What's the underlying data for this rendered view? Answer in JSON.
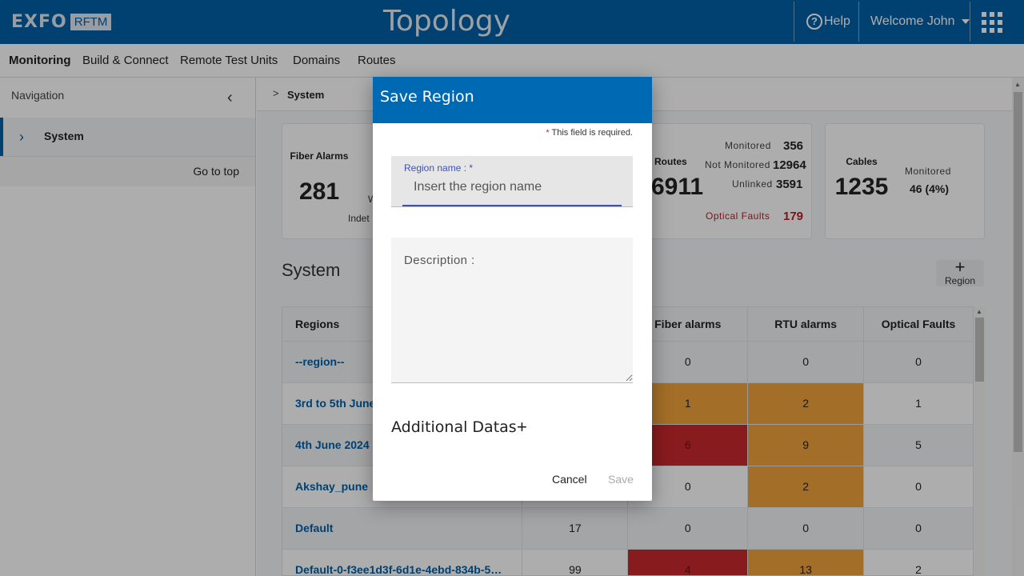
{
  "header": {
    "logo_brand": "EXFO",
    "logo_product": "RFTM",
    "title": "Topology",
    "help_label": "Help",
    "welcome_label": "Welcome John"
  },
  "menu": {
    "items": [
      "Monitoring",
      "Build & Connect",
      "Remote Test Units",
      "Domains",
      "Routes"
    ],
    "active": "Monitoring"
  },
  "sidebar": {
    "title": "Navigation",
    "item_label": "System",
    "go_to_top": "Go to top"
  },
  "breadcrumb": {
    "label": "System"
  },
  "summary": {
    "fiber_label": "Fiber Alarms",
    "fiber_count": "281",
    "partial_w": "W",
    "partial_indet": "Indet",
    "routes_label": "Routes",
    "routes_count": "6911",
    "routes_monitored_label": "Monitored",
    "routes_monitored_value": "356",
    "routes_not_monitored_label": "Not Monitored",
    "routes_not_monitored_value": "12964",
    "routes_unlinked_label": "Unlinked",
    "routes_unlinked_value": "3591",
    "optical_faults_label": "Optical Faults",
    "optical_faults_value": "179",
    "cables_label": "Cables",
    "cables_count": "1235",
    "cables_monitored_label": "Monitored",
    "cables_monitored_value": "46 (4%)"
  },
  "section": {
    "title": "System",
    "add_region_label": "Region"
  },
  "table": {
    "columns": [
      "Regions",
      "",
      "Fiber alarms",
      "RTU alarms",
      "Optical Faults"
    ],
    "rows": [
      {
        "name": "--region--",
        "col2": "",
        "fiber": "0",
        "rtu": "0",
        "faults": "0"
      },
      {
        "name": "3rd to 5th June",
        "col2": "",
        "fiber": "1",
        "rtu": "2",
        "faults": "1"
      },
      {
        "name": "4th June 2024",
        "col2": "",
        "fiber": "6",
        "rtu": "9",
        "faults": "5"
      },
      {
        "name": "Akshay_pune",
        "col2": "",
        "fiber": "0",
        "rtu": "2",
        "faults": "0"
      },
      {
        "name": "Default",
        "col2": "17",
        "fiber": "0",
        "rtu": "0",
        "faults": "0"
      },
      {
        "name": "Default-0-f3ee1d3f-6d1e-4ebd-834b-5…",
        "col2": "99",
        "fiber": "4",
        "rtu": "13",
        "faults": "2"
      }
    ]
  },
  "dialog": {
    "title": "Save Region",
    "required_star": "*",
    "required_note": "This field is required.",
    "region_name_label": "Region name : *",
    "region_name_placeholder": "Insert the region name",
    "region_name_value": "",
    "description_placeholder": "Description :",
    "additional_data_label": "Additional Datas",
    "additional_plus": "+",
    "cancel_label": "Cancel",
    "save_label": "Save"
  },
  "colors": {
    "brand_blue": "#0060a8",
    "dialog_header": "#0069b4",
    "alarm_orange": "#f0a23a",
    "alarm_red": "#c9282d",
    "fault_text": "#b52027"
  }
}
